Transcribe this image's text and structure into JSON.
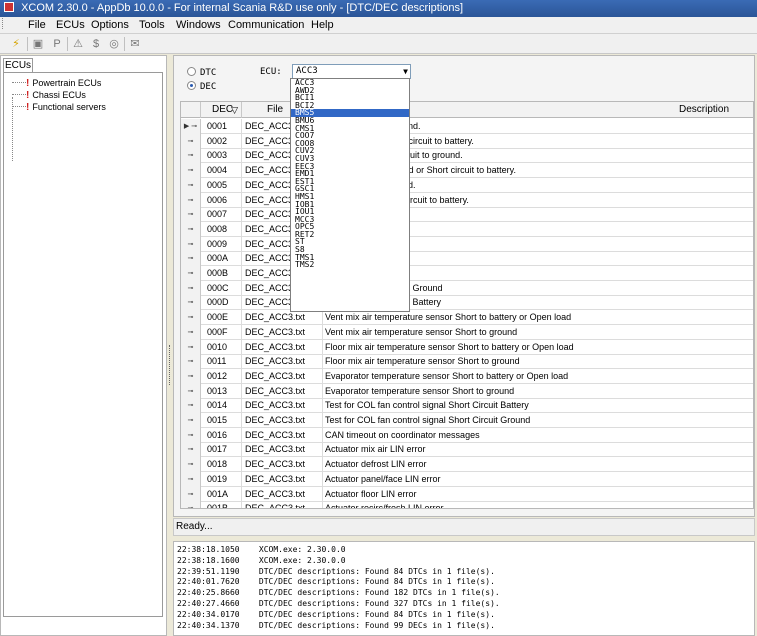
{
  "window": {
    "title": "XCOM 2.30.0 - AppDb 10.0.0 - For internal Scania R&D use only - [DTC/DEC descriptions]"
  },
  "menu": [
    "File",
    "ECUs",
    "Options",
    "Tools",
    "Windows",
    "Communication",
    "Help"
  ],
  "toolbar": {
    "icons": [
      "lightning-icon",
      "save-icon",
      "print-icon",
      "warning-icon",
      "dollar-icon",
      "gauge-icon",
      "email-icon"
    ]
  },
  "left_panel": {
    "tab": "ECUs",
    "tree": [
      "Powertrain ECUs",
      "Chassi ECUs",
      "Functional servers"
    ]
  },
  "mode": {
    "options": [
      "DTC",
      "DEC"
    ],
    "selected": "DEC"
  },
  "ecu": {
    "label": "ECU:",
    "selected": "ACC3",
    "options": [
      "ACC3",
      "AWD2",
      "BCI1",
      "BCI2",
      "BMS5",
      "BMU6",
      "CMS1",
      "COO7",
      "COO8",
      "CUV2",
      "CUV3",
      "EEC3",
      "EMD1",
      "EST1",
      "GSC1",
      "HMS1",
      "IOB1",
      "IOU1",
      "MCC3",
      "OPC5",
      "RET2",
      "ST",
      "S8",
      "TMS1",
      "TMS2"
    ],
    "highlighted": "BMS5"
  },
  "grid": {
    "headers": {
      "dec": "DEC",
      "file": "File",
      "description": "Description"
    },
    "rows": [
      {
        "dec": "0001",
        "file": "DEC_ACC3.txt",
        "desc": "t Short circuit to ground."
      },
      {
        "dec": "0002",
        "file": "DEC_ACC3.txt",
        "desc": "t Open load or Short circuit to battery."
      },
      {
        "dec": "0003",
        "file": "DEC_ACC3.txt",
        "desc": "nalog Input Short circuit to ground."
      },
      {
        "dec": "0004",
        "file": "DEC_ACC3.txt",
        "desc": "nalog Input Open load or Short circuit to battery."
      },
      {
        "dec": "0005",
        "file": "DEC_ACC3.txt",
        "desc": "Short circuit to ground."
      },
      {
        "dec": "0006",
        "file": "DEC_ACC3.txt",
        "desc": "Open load or Short circuit to battery."
      },
      {
        "dec": "0007",
        "file": "DEC_ACC3.txt",
        "desc": "s error."
      },
      {
        "dec": "0008",
        "file": "DEC_ACC3.txt",
        "desc": "ge fault"
      },
      {
        "dec": "0009",
        "file": "DEC_ACC3.txt",
        "desc": "temperature fault"
      },
      {
        "dec": "000A",
        "file": "DEC_ACC3.txt",
        "desc": "ed fault"
      },
      {
        "dec": "000B",
        "file": "DEC_ACC3.txt",
        "desc": "back signal fault"
      },
      {
        "dec": "000C",
        "file": "DEC_ACC3.txt",
        "desc": "ol signal Short Circuit Ground"
      },
      {
        "dec": "000D",
        "file": "DEC_ACC3.txt",
        "desc": "ol signal Short Circuit Battery"
      },
      {
        "dec": "000E",
        "file": "DEC_ACC3.txt",
        "desc": "Vent mix air temperature sensor Short to battery or Open load"
      },
      {
        "dec": "000F",
        "file": "DEC_ACC3.txt",
        "desc": "Vent mix air temperature sensor Short to ground"
      },
      {
        "dec": "0010",
        "file": "DEC_ACC3.txt",
        "desc": "Floor mix air temperature sensor Short to battery or Open load"
      },
      {
        "dec": "0011",
        "file": "DEC_ACC3.txt",
        "desc": "Floor mix air temperature sensor Short to ground"
      },
      {
        "dec": "0012",
        "file": "DEC_ACC3.txt",
        "desc": "Evaporator temperature sensor Short to battery or Open load"
      },
      {
        "dec": "0013",
        "file": "DEC_ACC3.txt",
        "desc": "Evaporator temperature sensor Short to ground"
      },
      {
        "dec": "0014",
        "file": "DEC_ACC3.txt",
        "desc": "Test for COL fan control signal Short Circuit Battery"
      },
      {
        "dec": "0015",
        "file": "DEC_ACC3.txt",
        "desc": "Test for COL fan control signal Short Circuit Ground"
      },
      {
        "dec": "0016",
        "file": "DEC_ACC3.txt",
        "desc": "CAN timeout on coordinator messages"
      },
      {
        "dec": "0017",
        "file": "DEC_ACC3.txt",
        "desc": "Actuator mix air LIN error"
      },
      {
        "dec": "0018",
        "file": "DEC_ACC3.txt",
        "desc": "Actuator defrost LIN error"
      },
      {
        "dec": "0019",
        "file": "DEC_ACC3.txt",
        "desc": "Actuator panel/face LIN error"
      },
      {
        "dec": "001A",
        "file": "DEC_ACC3.txt",
        "desc": "Actuator floor LIN error"
      },
      {
        "dec": "001B",
        "file": "DEC_ACC3.txt",
        "desc": "Actuator recirc/fresh LIN error"
      }
    ]
  },
  "status": "Ready...",
  "log": [
    "22:38:18.1050    XCOM.exe: 2.30.0.0",
    "22:38:18.1600    XCOM.exe: 2.30.0.0",
    "22:39:51.1190    DTC/DEC descriptions: Found 84 DTCs in 1 file(s).",
    "22:40:01.7620    DTC/DEC descriptions: Found 84 DTCs in 1 file(s).",
    "22:40:25.8660    DTC/DEC descriptions: Found 182 DTCs in 1 file(s).",
    "22:40:27.4660    DTC/DEC descriptions: Found 327 DTCs in 1 file(s).",
    "22:40:34.0170    DTC/DEC descriptions: Found 84 DTCs in 1 file(s).",
    "22:40:34.1370    DTC/DEC descriptions: Found 99 DECs in 1 file(s)."
  ]
}
